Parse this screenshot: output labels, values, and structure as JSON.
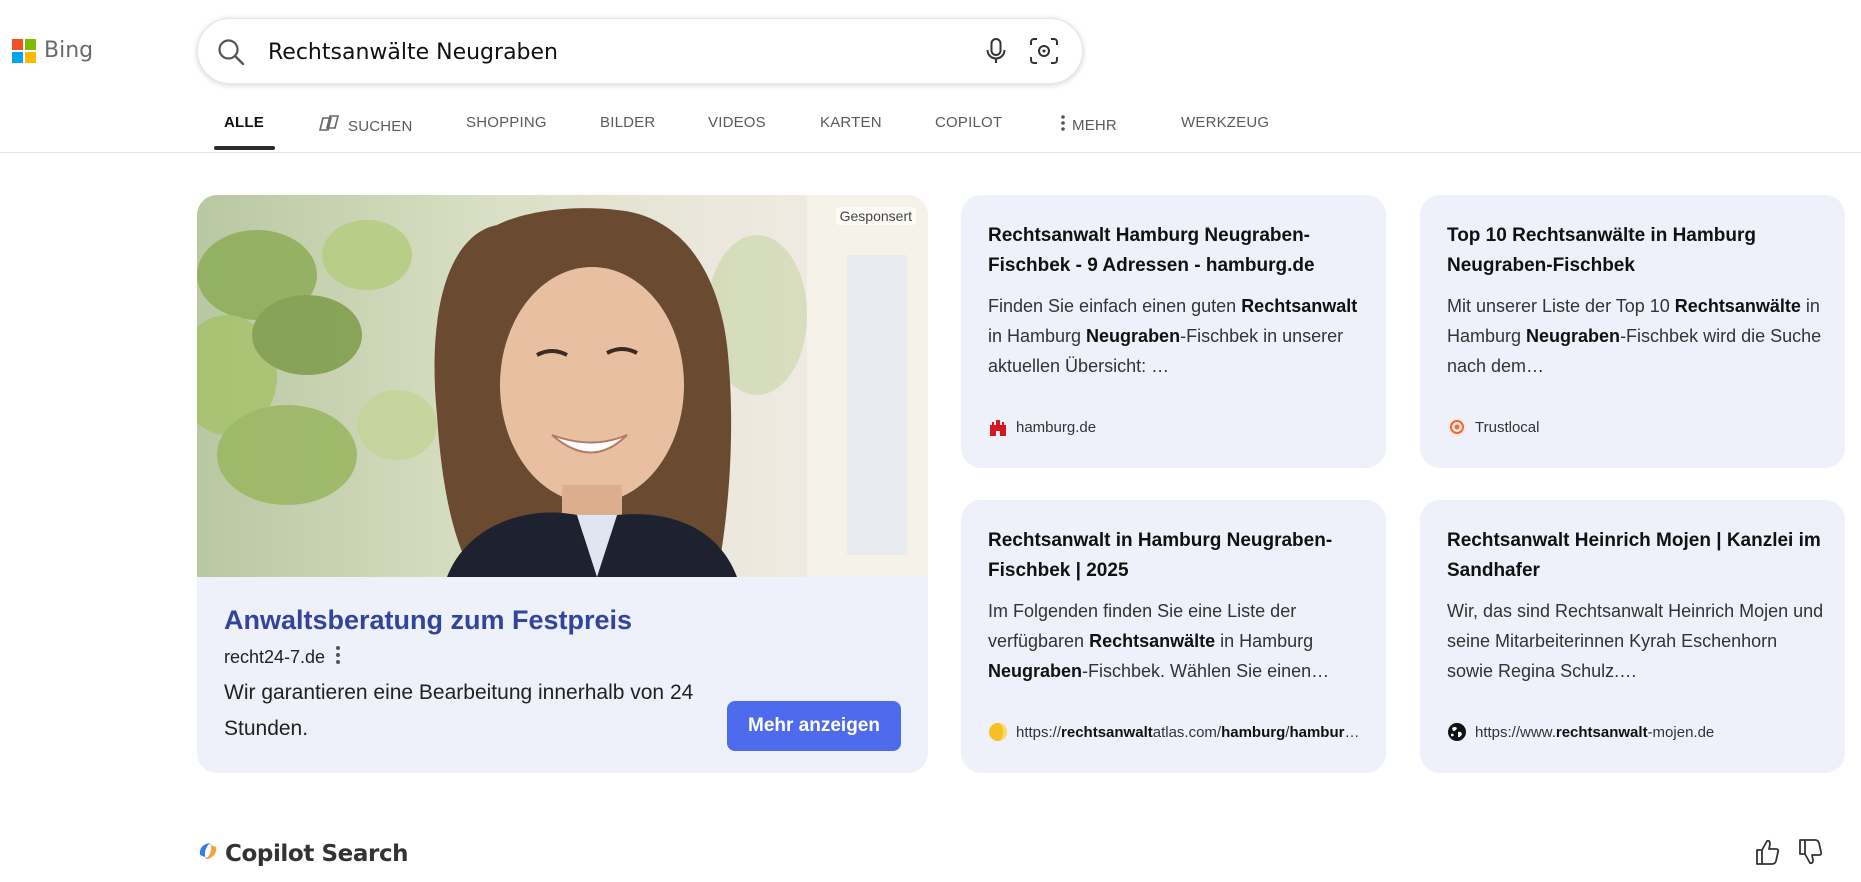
{
  "brand": {
    "logo_text": "Bing",
    "colors": [
      "#f25022",
      "#7fba00",
      "#00a4ef",
      "#ffb900"
    ]
  },
  "search": {
    "query": "Rechtsanwälte Neugraben",
    "search_icon": "search-icon",
    "mic_icon": "microphone-icon",
    "visual_search_icon": "camera-scan-icon"
  },
  "tabs": [
    {
      "label": "ALLE",
      "active": true
    },
    {
      "label": "SUCHEN",
      "icon": "copilot-icon"
    },
    {
      "label": "SHOPPING"
    },
    {
      "label": "BILDER"
    },
    {
      "label": "VIDEOS"
    },
    {
      "label": "KARTEN"
    },
    {
      "label": "COPILOT"
    },
    {
      "label": "MEHR",
      "icon": "more-vertical-icon"
    },
    {
      "label": "WERKZEUG"
    }
  ],
  "ad": {
    "sponsored": "Gesponsert",
    "title": "Anwaltsberatung zum Festpreis",
    "domain": "recht24-7.de",
    "description": "Wir garantieren eine Bearbeitung innerhalb von 24 Stunden.",
    "button": "Mehr anzeigen",
    "accent": "#4f6bed",
    "title_color": "#33459b"
  },
  "results": [
    {
      "title": "Rechtsanwalt Hamburg Neugraben-Fischbek - 9 Adressen - hamburg.de",
      "desc": [
        {
          "t": "Finden Sie einfach einen guten "
        },
        {
          "t": "Rechtsanwalt",
          "b": true
        },
        {
          "t": " in Hamburg "
        },
        {
          "t": "Neugraben",
          "b": true
        },
        {
          "t": "-Fischbek in unserer aktuellen Übersicht: …"
        }
      ],
      "source": [
        {
          "t": "hamburg.de"
        }
      ],
      "source_icon": "hamburg-castle-icon"
    },
    {
      "title": "Top 10 Rechtsanwälte in Hamburg Neugraben-Fischbek",
      "desc": [
        {
          "t": "Mit unserer Liste der Top 10 "
        },
        {
          "t": "Rechtsanwälte",
          "b": true
        },
        {
          "t": " in Hamburg "
        },
        {
          "t": "Neugraben",
          "b": true
        },
        {
          "t": "-Fischbek wird die Suche nach dem…"
        }
      ],
      "source": [
        {
          "t": "Trustlocal"
        }
      ],
      "source_icon": "trustlocal-icon"
    },
    {
      "title": "Rechtsanwalt in Hamburg Neugraben-Fischbek | 2025",
      "desc": [
        {
          "t": "Im Folgenden finden Sie eine Liste der verfügbaren "
        },
        {
          "t": "Rechtsanwälte",
          "b": true
        },
        {
          "t": " in Hamburg "
        },
        {
          "t": "Neugraben",
          "b": true
        },
        {
          "t": "-Fischbek. Wählen Sie einen…"
        }
      ],
      "source": [
        {
          "t": "https://"
        },
        {
          "t": "rechtsanwalt",
          "b": true
        },
        {
          "t": "atlas.com/"
        },
        {
          "t": "hamburg",
          "b": true
        },
        {
          "t": "/"
        },
        {
          "t": "hamburg",
          "b": true
        },
        {
          "t": "…"
        }
      ],
      "source_icon": "rechtsanwaltatlas-icon"
    },
    {
      "title": "Rechtsanwalt Heinrich Mojen | Kanzlei im Sandhafer",
      "desc": [
        {
          "t": "Wir, das sind Rechtsanwalt Heinrich Mojen und seine Mitarbeiterinnen Kyrah Eschenhorn sowie Regina Schulz.…"
        }
      ],
      "source": [
        {
          "t": "https://www."
        },
        {
          "t": "rechtsanwalt",
          "b": true
        },
        {
          "t": "-mojen.de"
        }
      ],
      "source_icon": "globe-icon"
    }
  ],
  "copilot": {
    "label": "Copilot Search",
    "thumbs_up_icon": "thumbs-up-icon",
    "thumbs_down_icon": "thumbs-down-icon"
  }
}
